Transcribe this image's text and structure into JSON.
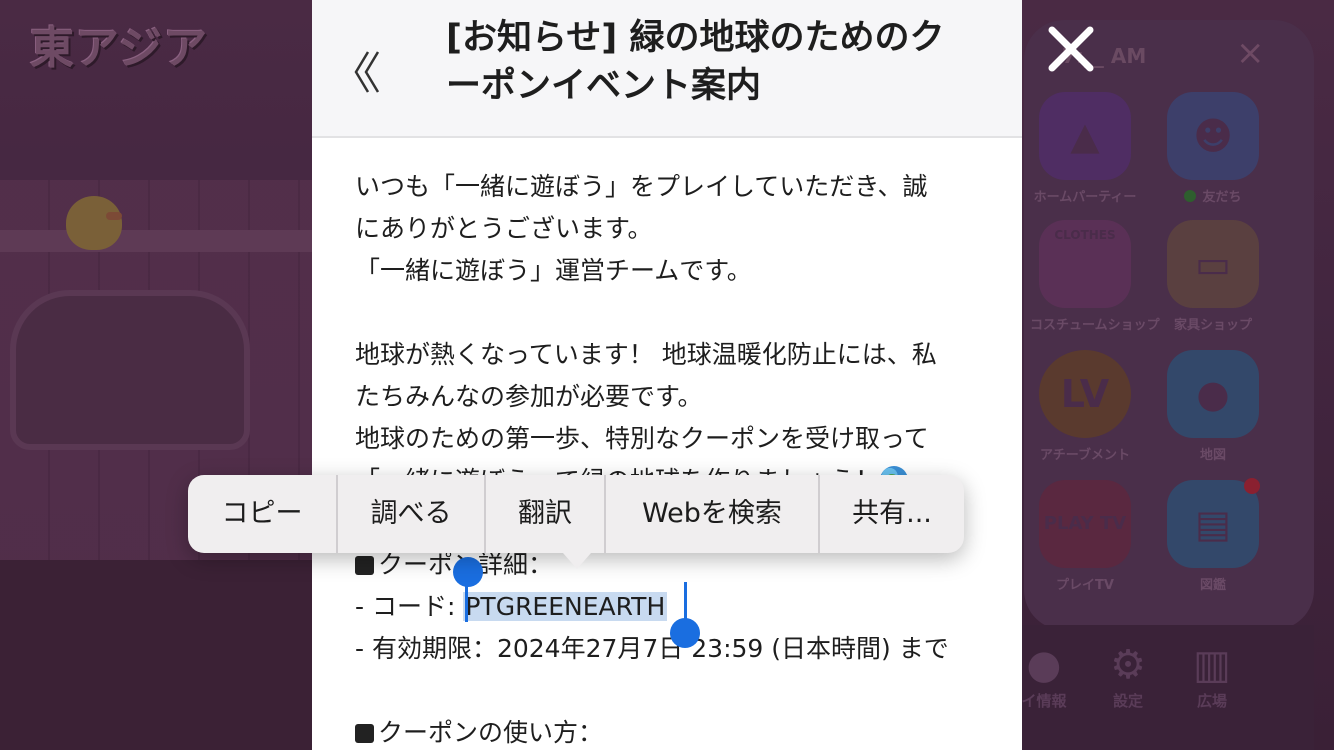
{
  "background": {
    "region_title": "東アジア",
    "status_time": "7:__ AM",
    "menu_items": [
      {
        "label": "ホームパーティー",
        "icon": "party-hat-icon"
      },
      {
        "label": "友だち",
        "icon": "friends-icon"
      },
      {
        "label": "コスチュームショップ",
        "icon": "clothes-shop-icon",
        "badge": "CLOTHES"
      },
      {
        "label": "家具ショップ",
        "icon": "sofa-icon"
      },
      {
        "label": "アチーブメント",
        "icon": "achievement-icon",
        "badge": "LV"
      },
      {
        "label": "地図",
        "icon": "map-pin-icon"
      },
      {
        "label": "プレイTV",
        "icon": "play-tv-icon",
        "badge": "PLAY TV"
      },
      {
        "label": "図鑑",
        "icon": "encyclopedia-icon"
      }
    ],
    "bottom_bar": [
      {
        "label": "イ情報",
        "icon": "profile-icon"
      },
      {
        "label": "設定",
        "icon": "gear-icon"
      },
      {
        "label": "広場",
        "icon": "plaza-icon"
      }
    ]
  },
  "notice": {
    "back_icon": "double-chevron-left-icon",
    "title_line1": "[お知らせ] 緑の地球のためのク",
    "title_line2": "ーポンイベント案内",
    "body": {
      "p1_line1": "いつも「一緒に遊ぼう」をプレイしていただき、誠",
      "p1_line2": "にありがとうございます。",
      "p1_line3": "「一緒に遊ぼう」運営チームです。",
      "p2_line1": "地球が熱くなっています！ 地球温暖化防止には、私",
      "p2_line2": "たちみんなの参加が必要です。",
      "p2_line3": "地球のための第一歩、特別なクーポンを受け取って",
      "p2_line4": "「一緒に遊ぼう」で緑の地球を作りましょう！",
      "details_heading": "クーポン詳細：",
      "code_label": "- コード: ",
      "code_value": "PTGREENEARTH",
      "expiry": "- 有効期限：2024年27月7日 23:59 (日本時間) まで",
      "howto_heading": "クーポンの使い方："
    }
  },
  "context_menu": {
    "items": [
      "コピー",
      "調べる",
      "翻訳",
      "Webを検索",
      "共有..."
    ]
  },
  "colors": {
    "selection_handle": "#1a6ee0",
    "selection_highlight": "#c8daf0",
    "dim_overlay": "#3f2438"
  }
}
